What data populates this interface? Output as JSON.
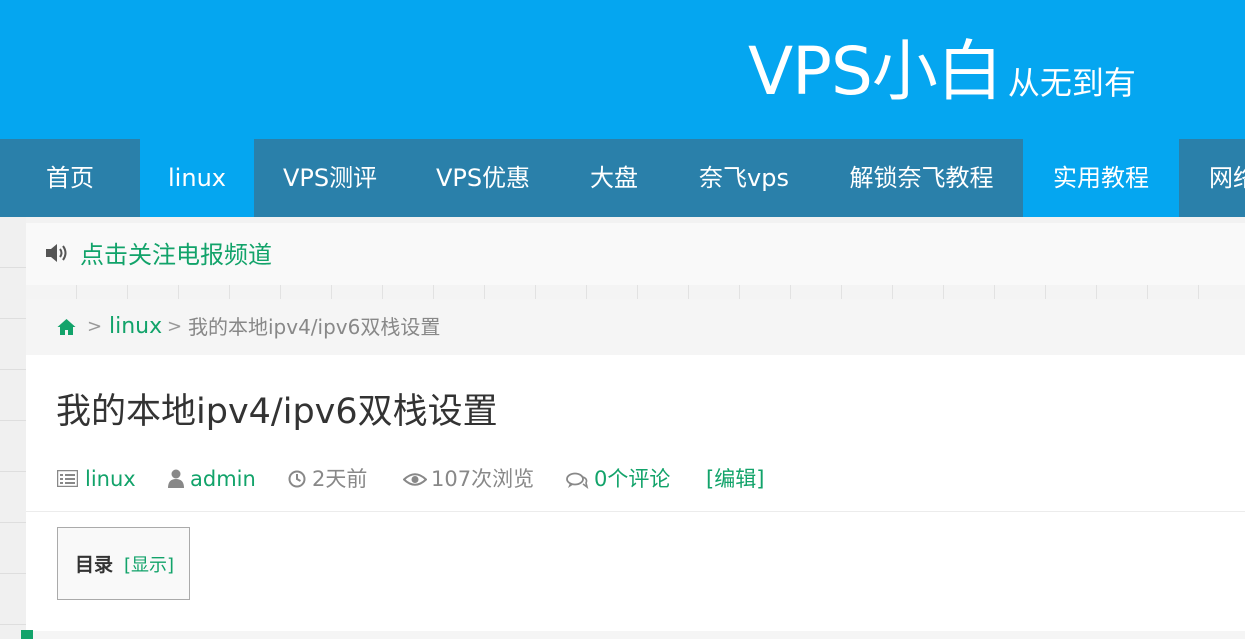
{
  "brand": {
    "title": "VPS小白",
    "subtitle": "从无到有",
    "header_color": "#05a6f0",
    "nav_dark_color": "#2a80aa",
    "accent_color": "#12a36a"
  },
  "nav": {
    "items": [
      {
        "label": "首页"
      },
      {
        "label": "linux"
      },
      {
        "label": "VPS测评"
      },
      {
        "label": "VPS优惠"
      },
      {
        "label": "大盘"
      },
      {
        "label": "奈飞vps"
      },
      {
        "label": "解锁奈飞教程"
      },
      {
        "label": "实用教程"
      },
      {
        "label": "网络"
      }
    ]
  },
  "notice": {
    "icon": "speaker-icon",
    "text": "点击关注电报频道"
  },
  "breadcrumb": {
    "home_icon": "home-icon",
    "separator": ">",
    "category": "linux",
    "current": "我的本地ipv4/ipv6双栈设置"
  },
  "article": {
    "title": "我的本地ipv4/ipv6双栈设置",
    "meta": {
      "category": "linux",
      "author": "admin",
      "time": "2天前",
      "views": "107次浏览",
      "comments": "0个评论",
      "edit": "[编辑]"
    },
    "toc": {
      "title": "目录",
      "toggle": "[显示]"
    }
  }
}
